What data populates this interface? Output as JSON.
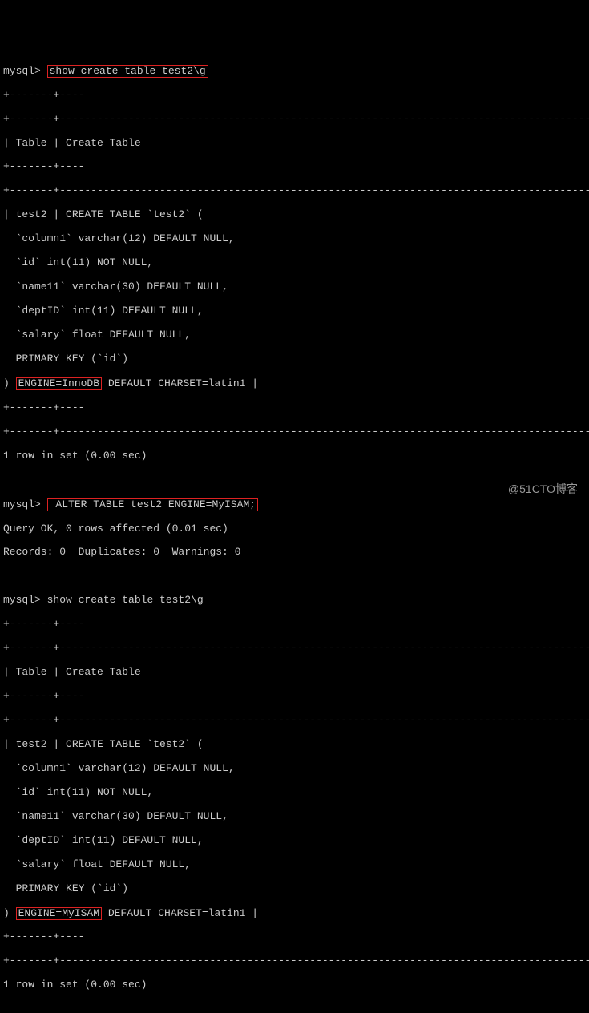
{
  "prompt": "mysql>",
  "cmd1": "show create table test2\\g",
  "sep_short": "+-------+----",
  "sep_long": "+-------+-------------------------------------------------------------------------------------------------------------------",
  "header_row": "| Table | Create Table",
  "t1": {
    "row_start": "| test2 | CREATE TABLE `test2` (",
    "c1": "  `column1` varchar(12) DEFAULT NULL,",
    "c2": "  `id` int(11) NOT NULL,",
    "c3": "  `name11` varchar(30) DEFAULT NULL,",
    "c4": "  `deptID` int(11) DEFAULT NULL,",
    "c5": "  `salary` float DEFAULT NULL,",
    "pk": "  PRIMARY KEY (`id`)",
    "close_prefix": ") ",
    "engine": "ENGINE=InnoDB",
    "close_suffix": " DEFAULT CHARSET=latin1 |"
  },
  "rowcount": "1 row in set (0.00 sec)",
  "cmd2": " ALTER TABLE test2 ENGINE=MyISAM;",
  "alter_ok": "Query OK, 0 rows affected (0.01 sec)",
  "alter_records": "Records: 0  Duplicates: 0  Warnings: 0",
  "cmd3": "show create table test2\\g",
  "t2": {
    "row_start": "| test2 | CREATE TABLE `test2` (",
    "c1": "  `column1` varchar(12) DEFAULT NULL,",
    "c2": "  `id` int(11) NOT NULL,",
    "c3": "  `name11` varchar(30) DEFAULT NULL,",
    "c4": "  `deptID` int(11) DEFAULT NULL,",
    "c5": "  `salary` float DEFAULT NULL,",
    "pk": "  PRIMARY KEY (`id`)",
    "close_prefix": ") ",
    "engine": "ENGINE=MyISAM",
    "close_suffix": " DEFAULT CHARSET=latin1 |"
  },
  "watermark": "@51CTO博客"
}
